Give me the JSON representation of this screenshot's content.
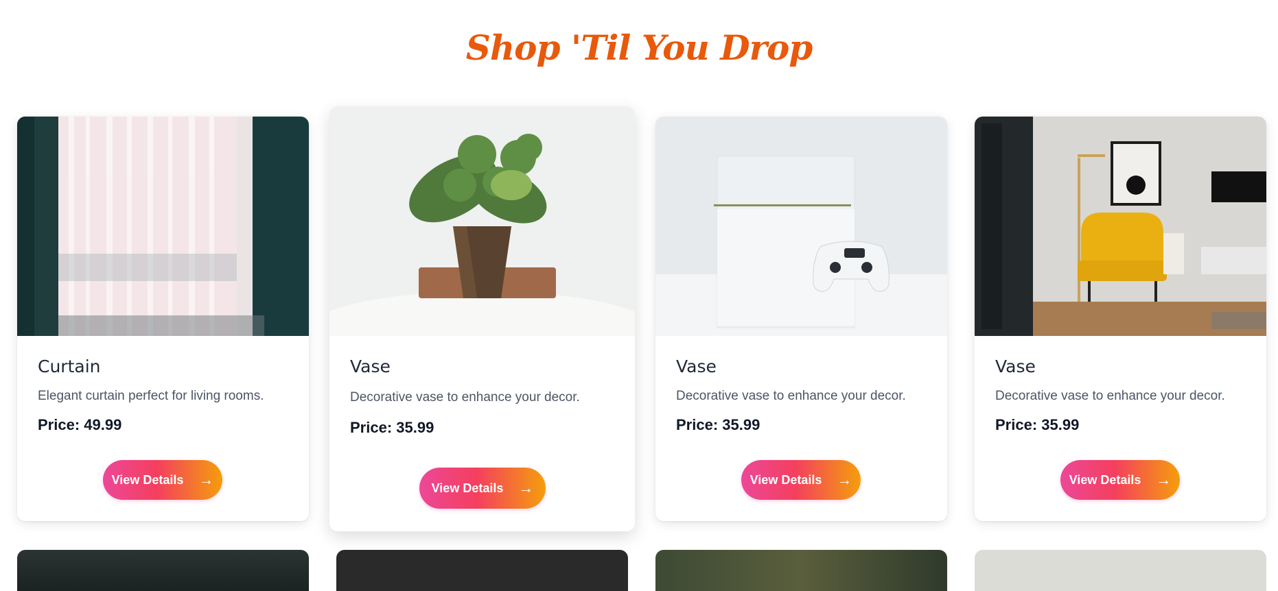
{
  "header": {
    "title": "Shop 'Til You Drop"
  },
  "colors": {
    "title": "#e8590c",
    "button_gradient_start": "#ec4899",
    "button_gradient_end": "#f59e0b"
  },
  "products": [
    {
      "name": "Curtain",
      "description": "Elegant curtain perfect for living rooms.",
      "price": "Price: 49.99",
      "button_label": "View Details",
      "button_icon": "arrow-right-icon",
      "image": "sheer-curtains-photo"
    },
    {
      "name": "Vase",
      "description": "Decorative vase to enhance your decor.",
      "price": "Price: 35.99",
      "button_label": "View Details",
      "button_icon": "arrow-right-icon",
      "image": "plant-in-wooden-vase-photo"
    },
    {
      "name": "Vase",
      "description": "Decorative vase to enhance your decor.",
      "price": "Price: 35.99",
      "button_label": "View Details",
      "button_icon": "arrow-right-icon",
      "image": "white-game-console-photo"
    },
    {
      "name": "Vase",
      "description": "Decorative vase to enhance your decor.",
      "price": "Price: 35.99",
      "button_label": "View Details",
      "button_icon": "arrow-right-icon",
      "image": "yellow-armchair-room-photo"
    }
  ],
  "arrow_glyph": "→"
}
